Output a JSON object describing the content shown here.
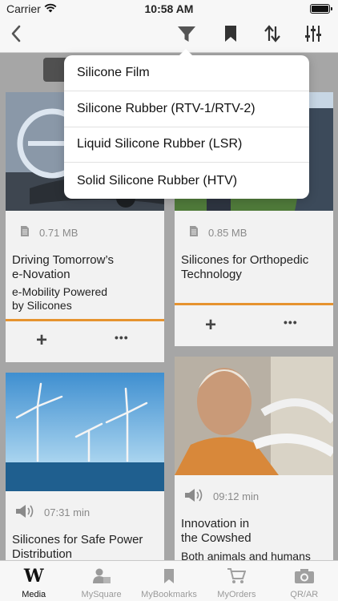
{
  "status_bar": {
    "carrier": "Carrier",
    "time": "10:58 AM"
  },
  "nav": {
    "back_icon": "chevron-left-icon",
    "filter_icon": "filter-icon",
    "bookmark_icon": "bookmark-icon",
    "sort_icon": "sort-arrows-icon",
    "settings_icon": "sliders-icon"
  },
  "filter_menu": {
    "items": [
      "Silicone Film",
      "Silicone Rubber (RTV-1/RTV-2)",
      "Liquid Silicone Rubber (LSR)",
      "Solid Silicone Rubber (HTV)"
    ]
  },
  "cards": [
    {
      "size": "0.71 MB",
      "title": "Driving Tomorrow’s e-Novation",
      "title_lines": [
        "Driving Tomorrow’s",
        "e-Novation"
      ],
      "subtitle_lines": [
        "e-Mobility Powered",
        "by Silicones"
      ],
      "type_icon": "document-icon"
    },
    {
      "size": "0.85 MB",
      "title_lines": [
        "Silicones for Orthopedic",
        "Technology"
      ],
      "type_icon": "document-icon"
    },
    {
      "duration": "07:31 min",
      "title_lines": [
        "Silicones for Safe Power",
        "Distribution"
      ],
      "type_icon": "audio-icon"
    },
    {
      "duration": "09:12 min",
      "title_lines": [
        "Innovation in",
        "the Cowshed"
      ],
      "subtitle_lines": [
        "Both animals and humans"
      ],
      "type_icon": "audio-icon"
    }
  ],
  "actions": {
    "add": "+",
    "more": "•••"
  },
  "tabs": [
    {
      "label": "Media",
      "icon": "wacker-logo-icon",
      "active": true
    },
    {
      "label": "MySquare",
      "icon": "person-card-icon",
      "active": false
    },
    {
      "label": "MyBookmarks",
      "icon": "bookmark-icon",
      "active": false
    },
    {
      "label": "MyOrders",
      "icon": "cart-icon",
      "active": false
    },
    {
      "label": "QR/AR",
      "icon": "camera-icon",
      "active": false
    }
  ],
  "colors": {
    "accent": "#e6932f",
    "background": "#a6a6a6",
    "card": "#f2f2f2"
  }
}
